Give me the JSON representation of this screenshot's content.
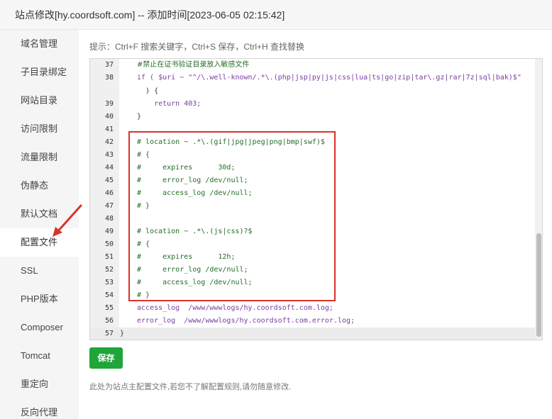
{
  "title": "站点修改[hy.coordsoft.com] -- 添加时间[2023-06-05 02:15:42]",
  "sidebar": {
    "items": [
      {
        "label": "域名管理"
      },
      {
        "label": "子目录绑定"
      },
      {
        "label": "网站目录"
      },
      {
        "label": "访问限制"
      },
      {
        "label": "流量限制"
      },
      {
        "label": "伪静态"
      },
      {
        "label": "默认文档"
      },
      {
        "label": "配置文件",
        "active": true
      },
      {
        "label": "SSL"
      },
      {
        "label": "PHP版本"
      },
      {
        "label": "Composer"
      },
      {
        "label": "Tomcat"
      },
      {
        "label": "重定向"
      },
      {
        "label": "反向代理"
      }
    ]
  },
  "hint": "提示：Ctrl+F 搜索关键字，Ctrl+S 保存，Ctrl+H 查找替换",
  "editor": {
    "lines": [
      {
        "num": "37",
        "text": "#禁止在证书验证目录放入敏感文件",
        "style": "comment"
      },
      {
        "num": "38",
        "text": "if ( $uri ~ \"^/\\.well-known/.*\\.(php|jsp|py|js|css|lua|ts|go|zip|tar\\.gz|rar|7z|sql|bak)$\"",
        "style": "if"
      },
      {
        "num": "",
        "text": "  ) {",
        "style": "plain"
      },
      {
        "num": "39",
        "text": "    return 403;",
        "style": "return"
      },
      {
        "num": "40",
        "text": "}",
        "style": "plain"
      },
      {
        "num": "41",
        "text": "",
        "style": "plain"
      },
      {
        "num": "42",
        "text": "# location ~ .*\\.(gif|jpg|jpeg|png|bmp|swf)$",
        "style": "comment"
      },
      {
        "num": "43",
        "text": "# {",
        "style": "comment"
      },
      {
        "num": "44",
        "text": "#     expires      30d;",
        "style": "comment"
      },
      {
        "num": "45",
        "text": "#     error_log /dev/null;",
        "style": "comment"
      },
      {
        "num": "46",
        "text": "#     access_log /dev/null;",
        "style": "comment"
      },
      {
        "num": "47",
        "text": "# }",
        "style": "comment"
      },
      {
        "num": "48",
        "text": "",
        "style": "plain"
      },
      {
        "num": "49",
        "text": "# location ~ .*\\.(js|css)?$",
        "style": "comment"
      },
      {
        "num": "50",
        "text": "# {",
        "style": "comment"
      },
      {
        "num": "51",
        "text": "#     expires      12h;",
        "style": "comment"
      },
      {
        "num": "52",
        "text": "#     error_log /dev/null;",
        "style": "comment"
      },
      {
        "num": "53",
        "text": "#     access_log /dev/null;",
        "style": "comment"
      },
      {
        "num": "54",
        "text": "# }",
        "style": "comment"
      },
      {
        "num": "55",
        "text": "access_log  /www/wwwlogs/hy.coordsoft.com.log;",
        "style": "directive"
      },
      {
        "num": "56",
        "text": "error_log  /www/wwwlogs/hy.coordsoft.com.error.log;",
        "style": "directive"
      },
      {
        "num": "57",
        "text": "}",
        "style": "active"
      }
    ]
  },
  "save_label": "保存",
  "footer_note": "此处为站点主配置文件,若您不了解配置规则,请勿随意修改.",
  "colors": {
    "accent": "#20a53a",
    "highlight_border": "#d9342b",
    "comment": "#236e25",
    "keyword": "#7a3e9d"
  }
}
